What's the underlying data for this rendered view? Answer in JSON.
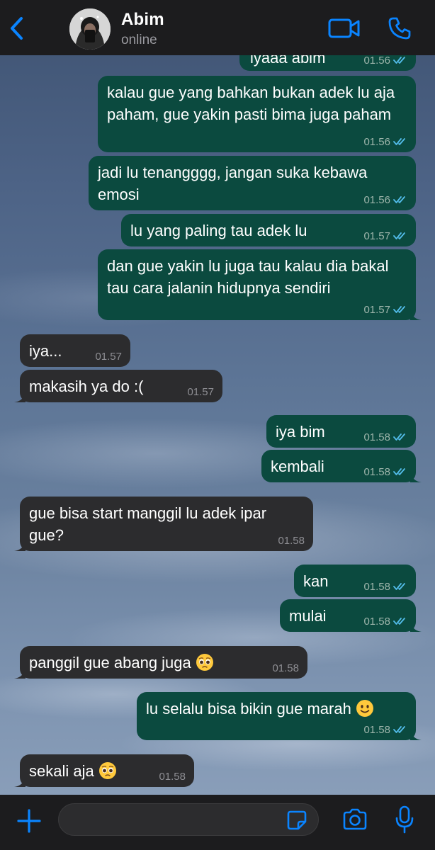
{
  "header": {
    "contact_name": "Abim",
    "status": "online"
  },
  "messages": [
    {
      "direction": "out",
      "text": "iyaaa abim",
      "time": "01.56",
      "read": true
    },
    {
      "direction": "out",
      "text": "kalau gue yang bahkan bukan adek lu aja paham, gue yakin pasti bima juga paham",
      "time": "01.56",
      "read": true
    },
    {
      "direction": "out",
      "text": "jadi lu tenangggg, jangan suka kebawa emosi",
      "time": "01.56",
      "read": true
    },
    {
      "direction": "out",
      "text": "lu yang paling tau adek lu",
      "time": "01.57",
      "read": true
    },
    {
      "direction": "out",
      "text": "dan gue yakin lu juga tau kalau dia bakal tau cara jalanin hidupnya sendiri",
      "time": "01.57",
      "read": true
    },
    {
      "direction": "in",
      "text": "iya...",
      "time": "01.57"
    },
    {
      "direction": "in",
      "text": "makasih ya do :(",
      "time": "01.57"
    },
    {
      "direction": "out",
      "text": "iya bim",
      "time": "01.58",
      "read": true
    },
    {
      "direction": "out",
      "text": "kembali",
      "time": "01.58",
      "read": true
    },
    {
      "direction": "in",
      "text": "gue bisa start manggil lu adek ipar gue?",
      "time": "01.58"
    },
    {
      "direction": "out",
      "text": "kan",
      "time": "01.58",
      "read": true
    },
    {
      "direction": "out",
      "text": "mulai",
      "time": "01.58",
      "read": true
    },
    {
      "direction": "in",
      "text": "panggil gue abang juga",
      "emoji": "pleading-face",
      "time": "01.58"
    },
    {
      "direction": "out",
      "text": "lu selalu bisa bikin gue marah",
      "emoji": "slightly-smiling-face",
      "time": "01.58",
      "read": true
    },
    {
      "direction": "in",
      "text": "sekali aja",
      "emoji": "pleading-face",
      "time": "01.58"
    }
  ],
  "composer": {
    "placeholder": ""
  },
  "icons": {
    "back": "chevron-left-icon",
    "video": "video-camera-icon",
    "call": "phone-icon",
    "add": "plus-icon",
    "sticker": "sticker-icon",
    "camera": "camera-icon",
    "mic": "microphone-icon"
  },
  "colors": {
    "accent": "#0a84ff",
    "outgoing_bubble": "#0b4a3f",
    "incoming_bubble": "#2c2c2e",
    "bar_background": "#1c1c1e",
    "read_tick": "#53bdeb"
  }
}
